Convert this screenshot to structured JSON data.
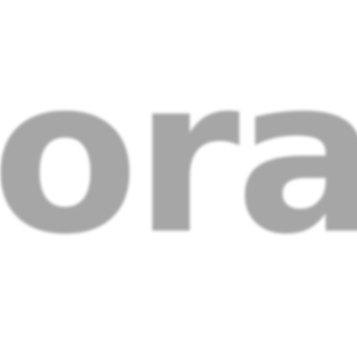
{
  "wordmark": {
    "text": "ora.",
    "color": "#a6a6a6"
  },
  "background": "#ffffff"
}
